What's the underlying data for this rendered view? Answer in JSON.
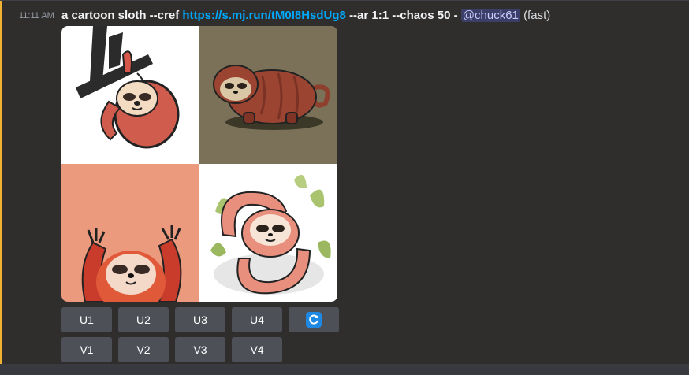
{
  "message": {
    "timestamp": "11:11 AM",
    "prompt": "a cartoon sloth --cref",
    "link": "https://s.mj.run/tM0I8HsdUg8",
    "params": "--ar 1:1 --chaos 50 -",
    "mention": "@chuck61",
    "mode": "(fast)"
  },
  "images": [
    {
      "name": "sloth-hanging-branch",
      "background": "#ffffff"
    },
    {
      "name": "sloth-walking",
      "background": "#7a7158"
    },
    {
      "name": "sloth-arms-raised",
      "background": "#ec9a7d"
    },
    {
      "name": "sloth-curled-leaves",
      "background": "#ffffff"
    }
  ],
  "buttons": {
    "upscale": [
      "U1",
      "U2",
      "U3",
      "U4"
    ],
    "variation": [
      "V1",
      "V2",
      "V3",
      "V4"
    ],
    "reroll_icon": "refresh-icon"
  },
  "colors": {
    "background": "#313338",
    "mention_bar": "#f0b232",
    "link": "#00a8fc",
    "button": "#4e5058",
    "reroll_icon": "#1e88e5"
  }
}
